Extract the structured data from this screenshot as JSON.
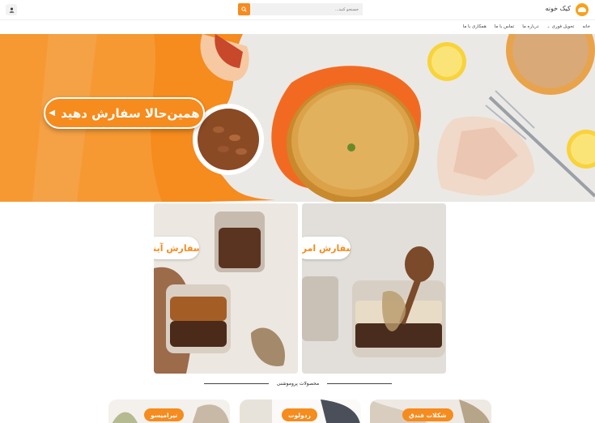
{
  "header": {
    "brand": "کیک خونه",
    "search_placeholder": "جستجو کنید...",
    "search_icon": "search-icon",
    "user_icon": "user-icon"
  },
  "nav": {
    "items": [
      {
        "label": "خانه"
      },
      {
        "label": "تحویل فوری",
        "has_dropdown": true
      },
      {
        "label": "درباره ما"
      },
      {
        "label": "تماس با ما"
      },
      {
        "label": "همکاری با ما"
      }
    ]
  },
  "hero": {
    "cta_label": "همین‌حالا سفارش دهید",
    "cta_icon": "play-left-icon"
  },
  "cards": {
    "left_label": "سفارش آینده",
    "right_label": "سفارش امروز"
  },
  "section": {
    "title": "محصولات پروموشنی"
  },
  "products": [
    {
      "label": "تیرامیسو"
    },
    {
      "label": "ردولوت"
    },
    {
      "label": "شکلات فندق"
    }
  ],
  "colors": {
    "accent": "#f68b1e",
    "hero_bg": "#ebe9e6"
  }
}
